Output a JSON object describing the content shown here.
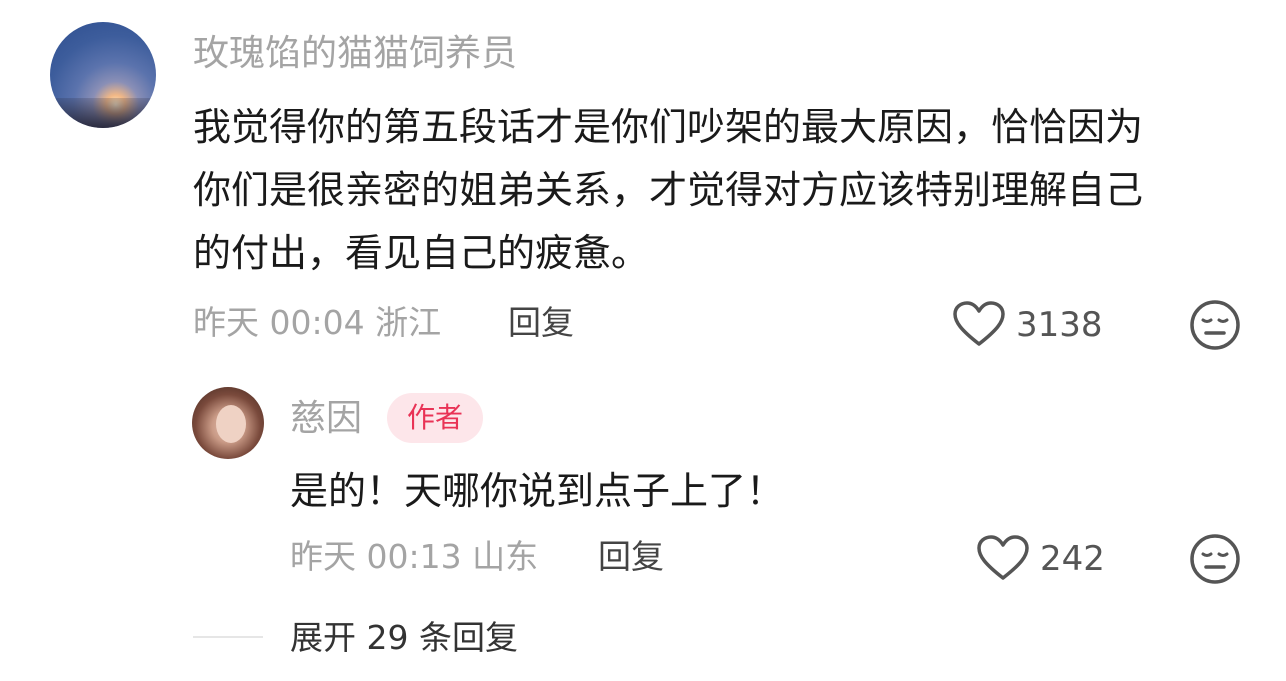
{
  "comment": {
    "username": "玫瑰馅的猫猫饲养员",
    "lines": [
      "我觉得你的第五段话才是你们吵架的最大原因，恰恰因为",
      "你们是很亲密的姐弟关系，才觉得对方应该特别理解自己",
      "的付出，看见自己的疲惫。"
    ],
    "time": "昨天 00:04",
    "location": "浙江",
    "reply_label": "回复",
    "likes": "3138",
    "like_icon": "heart-outline-icon",
    "dislike_icon": "meh-face-icon"
  },
  "reply": {
    "username": "慈因",
    "badge": "作者",
    "badge_color": "#e93356",
    "text": "是的！天哪你说到点子上了！",
    "time": "昨天 00:13",
    "location": "山东",
    "reply_label": "回复",
    "likes": "242",
    "like_icon": "heart-outline-icon",
    "dislike_icon": "meh-face-icon"
  },
  "expand": {
    "label": "展开 29 条回复"
  }
}
